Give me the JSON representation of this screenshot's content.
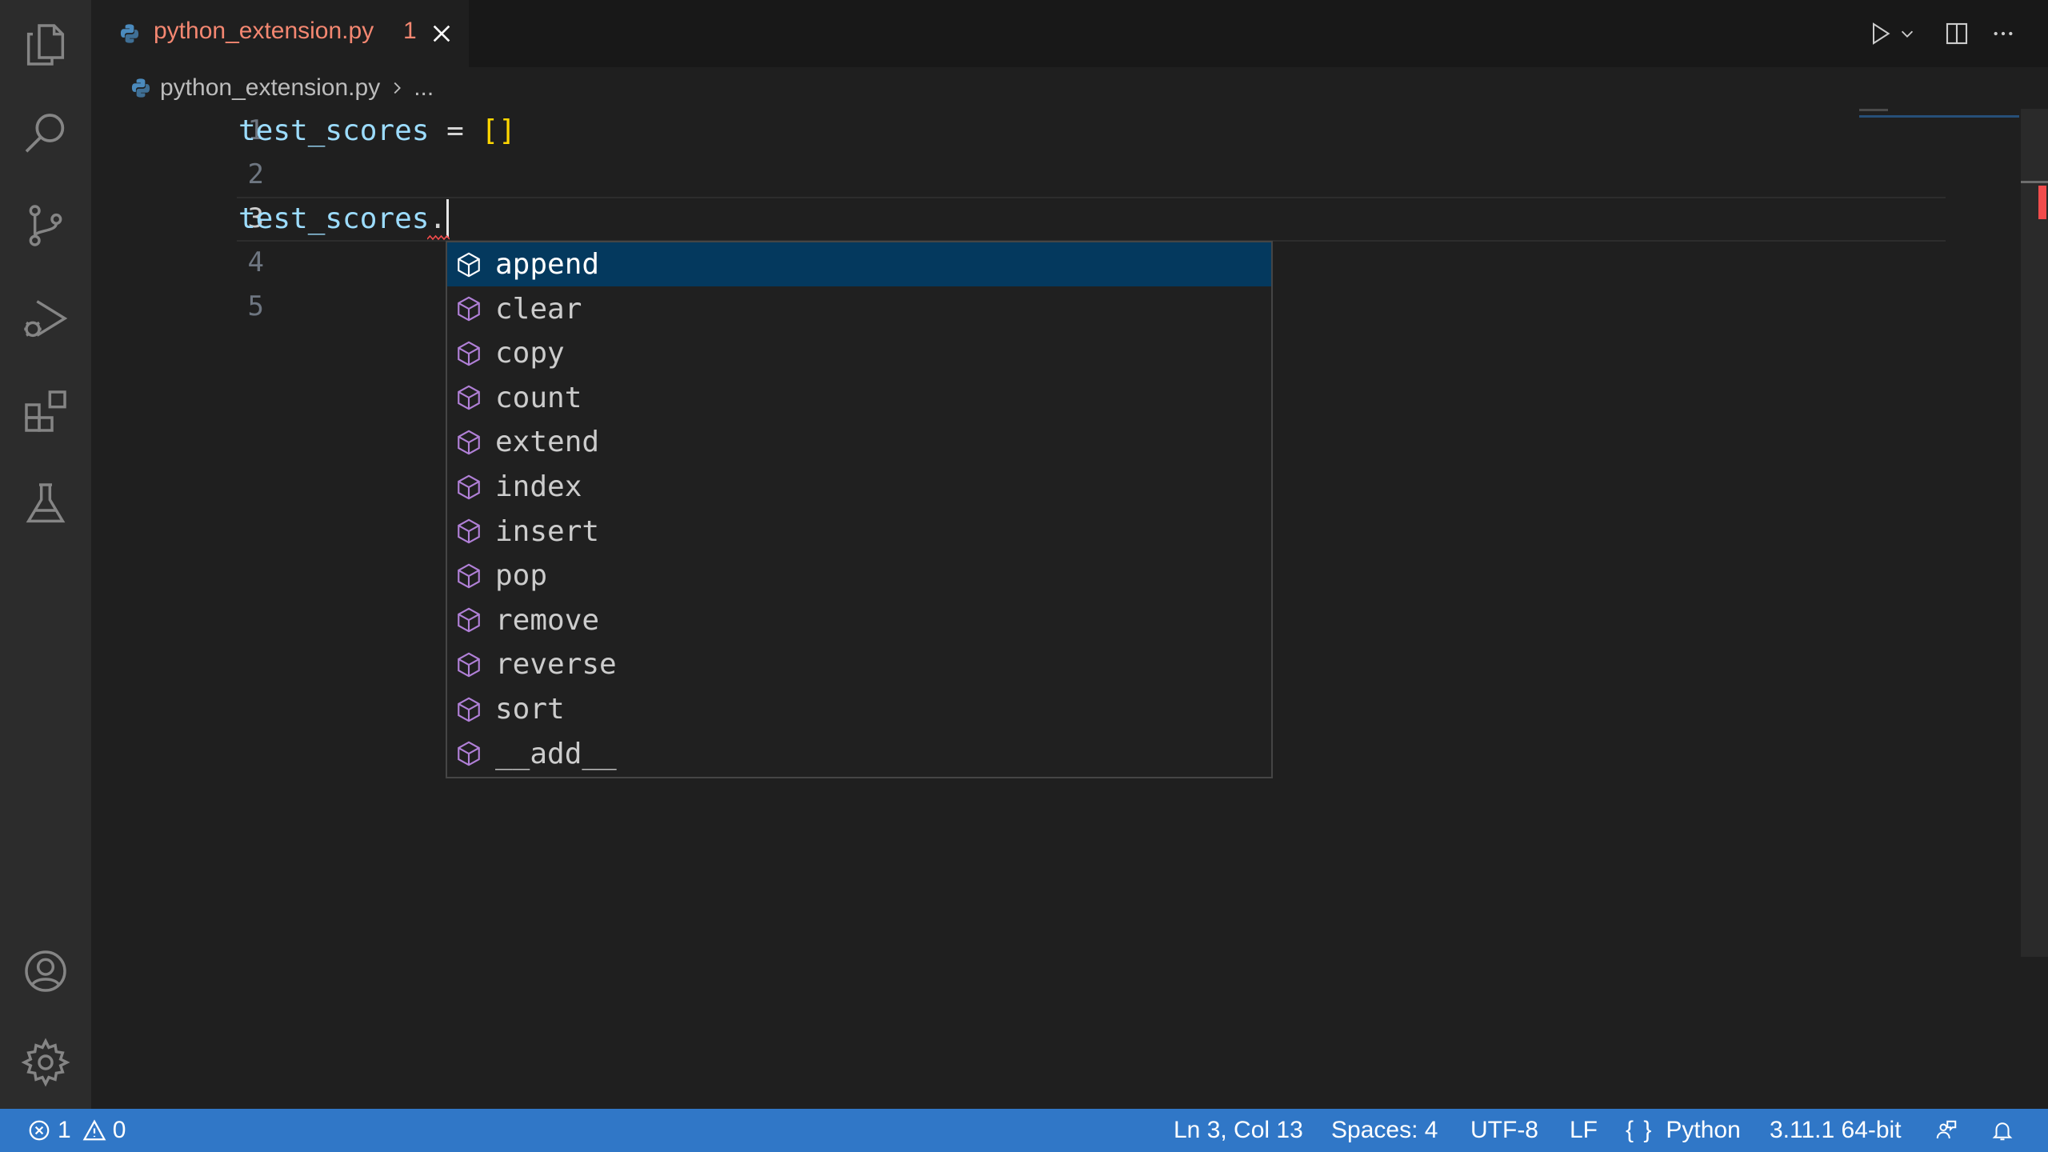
{
  "tab": {
    "filename": "python_extension.py",
    "problem_count": "1"
  },
  "breadcrumb": {
    "file": "python_extension.py",
    "more": "..."
  },
  "editor": {
    "line_numbers": [
      "1",
      "2",
      "3",
      "4",
      "5"
    ],
    "line1": {
      "var": "test_scores",
      "op": " = ",
      "value": "[]"
    },
    "line3": {
      "var": "test_scores",
      "op": "."
    }
  },
  "suggestions": [
    "append",
    "clear",
    "copy",
    "count",
    "extend",
    "index",
    "insert",
    "pop",
    "remove",
    "reverse",
    "sort",
    "__add__"
  ],
  "status": {
    "errors": "1",
    "warnings": "0",
    "position": "Ln 3, Col 13",
    "spaces": "Spaces: 4",
    "encoding": "UTF-8",
    "eol": "LF",
    "language_icon": "{ }",
    "language": "Python",
    "interpreter": "3.11.1 64-bit"
  },
  "colors": {
    "accent": "#3077c7",
    "selection": "#04395e",
    "tab_error": "#f48771",
    "method_icon": "#b180d7"
  }
}
